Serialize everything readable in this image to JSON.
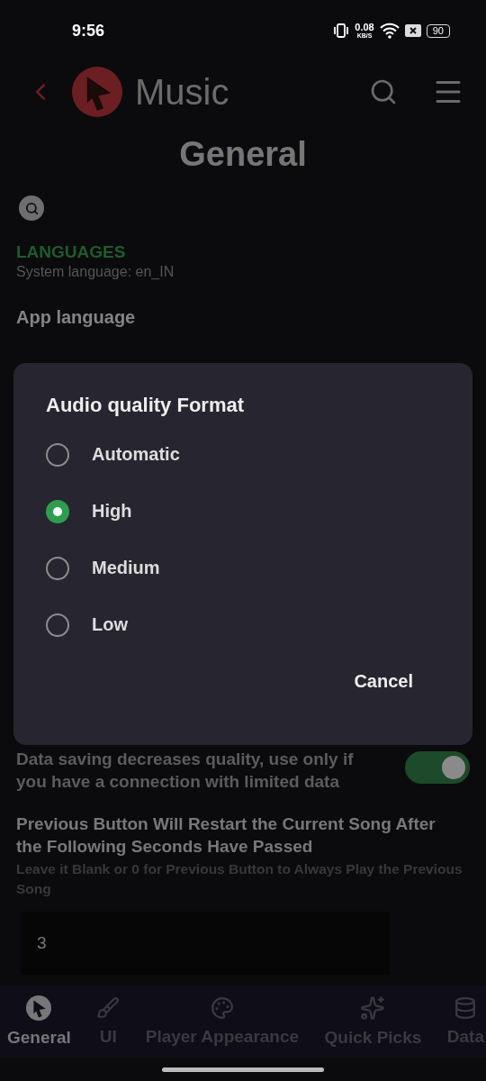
{
  "status_bar": {
    "time": "9:56",
    "net_speed": "0.08",
    "net_unit": "KB/S",
    "battery": "90"
  },
  "header": {
    "app_name": "Music"
  },
  "page_title": "General",
  "section": {
    "title": "LANGUAGES",
    "subtitle": "System language: en_IN"
  },
  "app_language_label": "App language",
  "dialog": {
    "title": "Audio quality Format",
    "options": [
      {
        "label": "Automatic",
        "selected": false
      },
      {
        "label": "High",
        "selected": true
      },
      {
        "label": "Medium",
        "selected": false
      },
      {
        "label": "Low",
        "selected": false
      }
    ],
    "cancel": "Cancel"
  },
  "data_saving": {
    "description": "Data saving decreases quality, use only if you have a connection with limited data",
    "on": true
  },
  "previous_button": {
    "title": "Previous Button Will Restart the Current Song After the Following Seconds Have Passed",
    "hint": "Leave it Blank or 0 for Previous Button to Always Play the Previous Song",
    "value": "3"
  },
  "bottom_nav": [
    {
      "kind": "logo",
      "label": "General",
      "selected": true
    },
    {
      "kind": "brush",
      "label": "UI",
      "selected": false
    },
    {
      "kind": "palette",
      "label": "Player Appearance",
      "selected": false
    },
    {
      "kind": "sparkles",
      "label": "Quick Picks",
      "selected": false
    },
    {
      "kind": "database",
      "label": "Data",
      "selected": false
    }
  ]
}
